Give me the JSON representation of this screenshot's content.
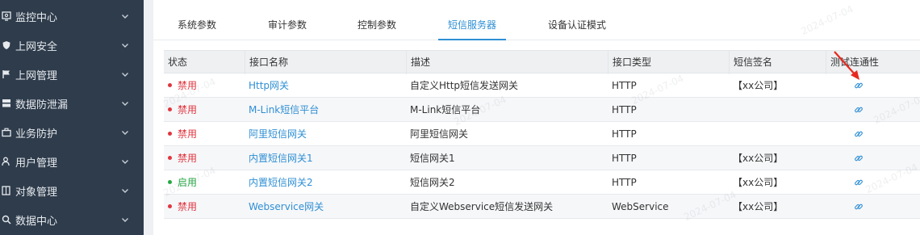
{
  "sidebar": {
    "items": [
      {
        "label": "监控中心",
        "icon": "monitor-icon"
      },
      {
        "label": "上网安全",
        "icon": "shield-icon"
      },
      {
        "label": "上网管理",
        "icon": "flag-icon"
      },
      {
        "label": "数据防泄漏",
        "icon": "database-icon"
      },
      {
        "label": "业务防护",
        "icon": "briefcase-icon"
      },
      {
        "label": "用户管理",
        "icon": "user-icon"
      },
      {
        "label": "对象管理",
        "icon": "object-icon"
      },
      {
        "label": "数据中心",
        "icon": "search-icon"
      }
    ]
  },
  "tabs": [
    {
      "label": "系统参数",
      "active": false
    },
    {
      "label": "审计参数",
      "active": false
    },
    {
      "label": "控制参数",
      "active": false
    },
    {
      "label": "短信服务器",
      "active": true
    },
    {
      "label": "设备认证模式",
      "active": false
    }
  ],
  "table": {
    "headers": [
      "状态",
      "接口名称",
      "描述",
      "接口类型",
      "短信签名",
      "测试连通性"
    ],
    "rows": [
      {
        "status": "禁用",
        "enabled": false,
        "name": "Http网关",
        "desc": "自定义Http短信发送网关",
        "type": "HTTP",
        "sign": "【xx公司】"
      },
      {
        "status": "禁用",
        "enabled": false,
        "name": "M-Link短信平台",
        "desc": "M-Link短信平台",
        "type": "HTTP",
        "sign": ""
      },
      {
        "status": "禁用",
        "enabled": false,
        "name": "阿里短信网关",
        "desc": "阿里短信网关",
        "type": "HTTP",
        "sign": ""
      },
      {
        "status": "禁用",
        "enabled": false,
        "name": "内置短信网关1",
        "desc": "短信网关1",
        "type": "HTTP",
        "sign": "【xx公司】"
      },
      {
        "status": "启用",
        "enabled": true,
        "name": "内置短信网关2",
        "desc": "短信网关2",
        "type": "HTTP",
        "sign": "【xx公司】"
      },
      {
        "status": "禁用",
        "enabled": false,
        "name": "Webservice网关",
        "desc": "自定义Webservice短信发送网关",
        "type": "WebService",
        "sign": "【xx公司】"
      }
    ]
  },
  "watermark_text": "2024-07-04",
  "colors": {
    "sidebar_bg": "#2f3c4c",
    "accent": "#2f8fd4",
    "disabled": "#e0363f",
    "enabled": "#27a844",
    "arrow": "#e8281e"
  }
}
